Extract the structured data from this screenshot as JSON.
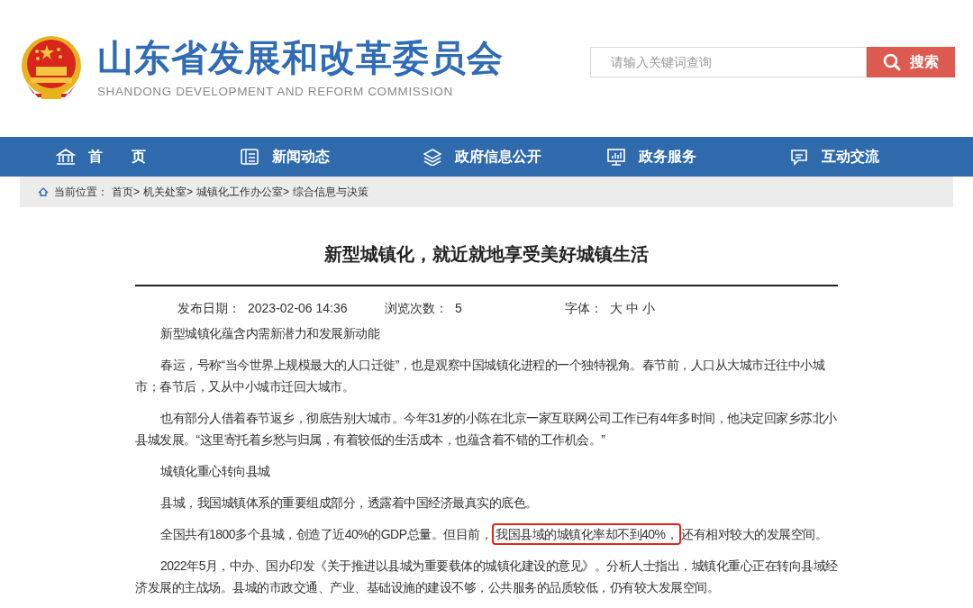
{
  "header": {
    "title": "山东省发展和改革委员会",
    "subtitle": "SHANDONG DEVELOPMENT AND REFORM COMMISSION",
    "search": {
      "placeholder": "请输入关键词查询",
      "button": "搜索"
    }
  },
  "nav": [
    {
      "label": "首 页"
    },
    {
      "label": "新闻动态"
    },
    {
      "label": "政府信息公开"
    },
    {
      "label": "政务服务"
    },
    {
      "label": "互动交流"
    }
  ],
  "breadcrumb": {
    "label": "当前位置：",
    "items": [
      "首页>",
      "机关处室>",
      "城镇化工作办公室>",
      "综合信息与决策"
    ]
  },
  "article": {
    "title": "新型城镇化，就近就地享受美好城镇生活",
    "meta": [
      {
        "label": "发布日期：",
        "value": "2023-02-06 14:36"
      },
      {
        "label": "浏览次数：",
        "value": "5"
      },
      {
        "label": "字体：",
        "value": "大 中 小"
      }
    ],
    "paragraphs": [
      {
        "parts": [
          {
            "text": "新型城镇化蕴含内需新潜力和发展新动能",
            "highlighted": false
          }
        ]
      },
      {
        "parts": [
          {
            "text": "春运，号称“当今世界上规模最大的人口迁徙”，也是观察中国城镇化进程的一个独特视角。春节前，人口从大城市迁往中小城市；春节后，又从中小城市迁回大城市。",
            "highlighted": false
          }
        ]
      },
      {
        "parts": [
          {
            "text": "也有部分人借着春节返乡，彻底告别大城市。今年31岁的小陈在北京一家互联网公司工作已有4年多时间，他决定回家乡苏北小县城发展。“这里寄托着乡愁与归属，有着较低的生活成本，也蕴含着不错的工作机会。”",
            "highlighted": false
          }
        ]
      },
      {
        "parts": [
          {
            "text": "城镇化重心转向县城",
            "highlighted": false
          }
        ]
      },
      {
        "parts": [
          {
            "text": "县城，我国城镇体系的重要组成部分，透露着中国经济最真实的底色。",
            "highlighted": false
          }
        ]
      },
      {
        "parts": [
          {
            "text": "全国共有1800多个县城，创造了近40%的GDP总量。但目前，",
            "highlighted": false
          },
          {
            "text": "我国县域的城镇化率却不到40%，",
            "highlighted": true
          },
          {
            "text": "还有相对较大的发展空间。",
            "highlighted": false
          }
        ]
      },
      {
        "parts": [
          {
            "text": "2022年5月，中办、国办印发《关于推进以县城为重要载体的城镇化建设的意见》。分析人士指出，城镇化重心正在转向县域经济发展的主战场。县城的市政交通、产业、基础设施的建设不够，公共服务的品质较低，仍有较大发展空间。",
            "highlighted": false
          }
        ]
      }
    ]
  }
}
